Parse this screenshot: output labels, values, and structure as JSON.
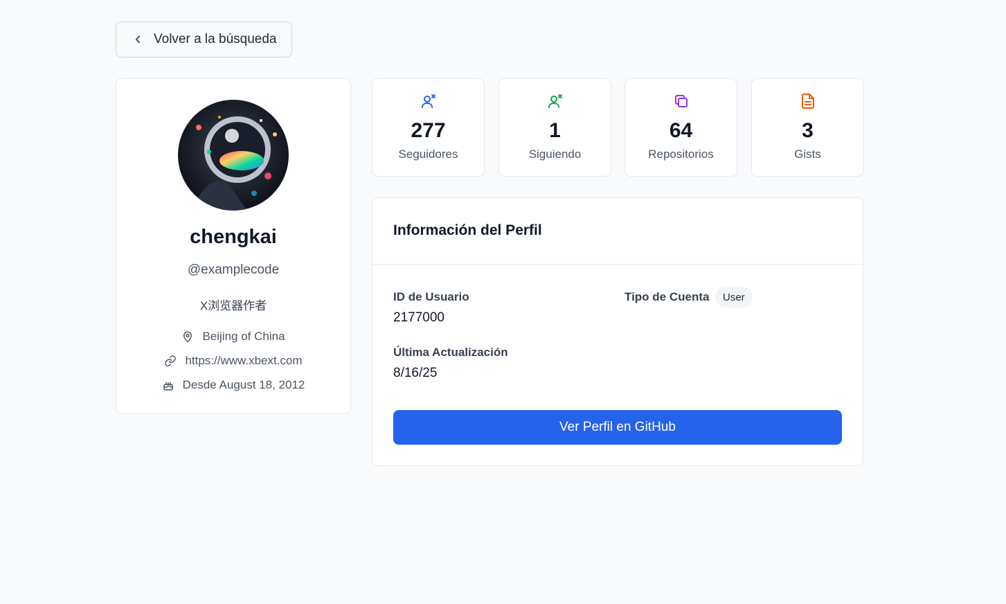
{
  "nav": {
    "back_label": "Volver a la búsqueda"
  },
  "profile": {
    "name": "chengkai",
    "login": "@examplecode",
    "bio": "X浏览器作者",
    "location": "Beijing of China",
    "website": "https://www.xbext.com",
    "joined": "Desde August 18, 2012"
  },
  "stats": [
    {
      "value": "277",
      "label": "Seguidores",
      "icon": "users-icon",
      "color": "#2563eb"
    },
    {
      "value": "1",
      "label": "Siguiendo",
      "icon": "user-check-icon",
      "color": "#16a34a"
    },
    {
      "value": "64",
      "label": "Repositorios",
      "icon": "repo-icon",
      "color": "#9333ea"
    },
    {
      "value": "3",
      "label": "Gists",
      "icon": "file-icon",
      "color": "#ea580c"
    }
  ],
  "info": {
    "title": "Información del Perfil",
    "user_id_label": "ID de Usuario",
    "user_id_value": "2177000",
    "account_type_label": "Tipo de Cuenta",
    "account_type_value": "User",
    "updated_label": "Última Actualización",
    "updated_value": "8/16/25",
    "github_button": "Ver Perfil en GitHub"
  },
  "colors": {
    "primary": "#2563eb",
    "background": "#f9fafb"
  }
}
